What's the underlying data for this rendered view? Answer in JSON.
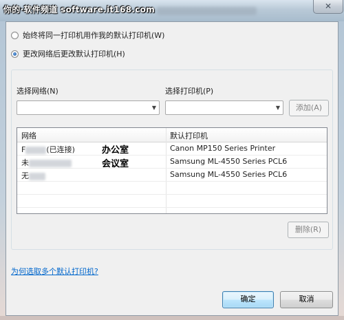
{
  "watermark": "你的·软件频道 software.it168.com",
  "window": {
    "close_glyph": "✕"
  },
  "options": {
    "same_printer_label": "始终将同一打印机用作我的默认打印机(W)",
    "change_by_network_label": "更改网络后更改默认打印机(H)",
    "selected": "change_by_network"
  },
  "selectors": {
    "network_label": "选择网络(N)",
    "printer_label": "选择打印机(P)",
    "network_value": "",
    "printer_value": "",
    "add_button": "添加(A)"
  },
  "table": {
    "columns": [
      "网络",
      "默认打印机"
    ],
    "rows": [
      {
        "network_prefix": "F",
        "network_suffix": "(已连接)",
        "printer": "Canon MP150 Series Printer",
        "annotation": "办公室"
      },
      {
        "network_prefix": "未",
        "network_suffix": "",
        "printer": "Samsung ML-4550 Series PCL6",
        "annotation": "会议室"
      },
      {
        "network_prefix": "无",
        "network_suffix": "",
        "printer": "Samsung ML-4550 Series PCL6",
        "annotation": ""
      }
    ],
    "empty_rows": 3
  },
  "delete_button": "删除(R)",
  "help_link": "为何选取多个默认打印机?",
  "footer": {
    "ok": "确定",
    "cancel": "取消"
  }
}
